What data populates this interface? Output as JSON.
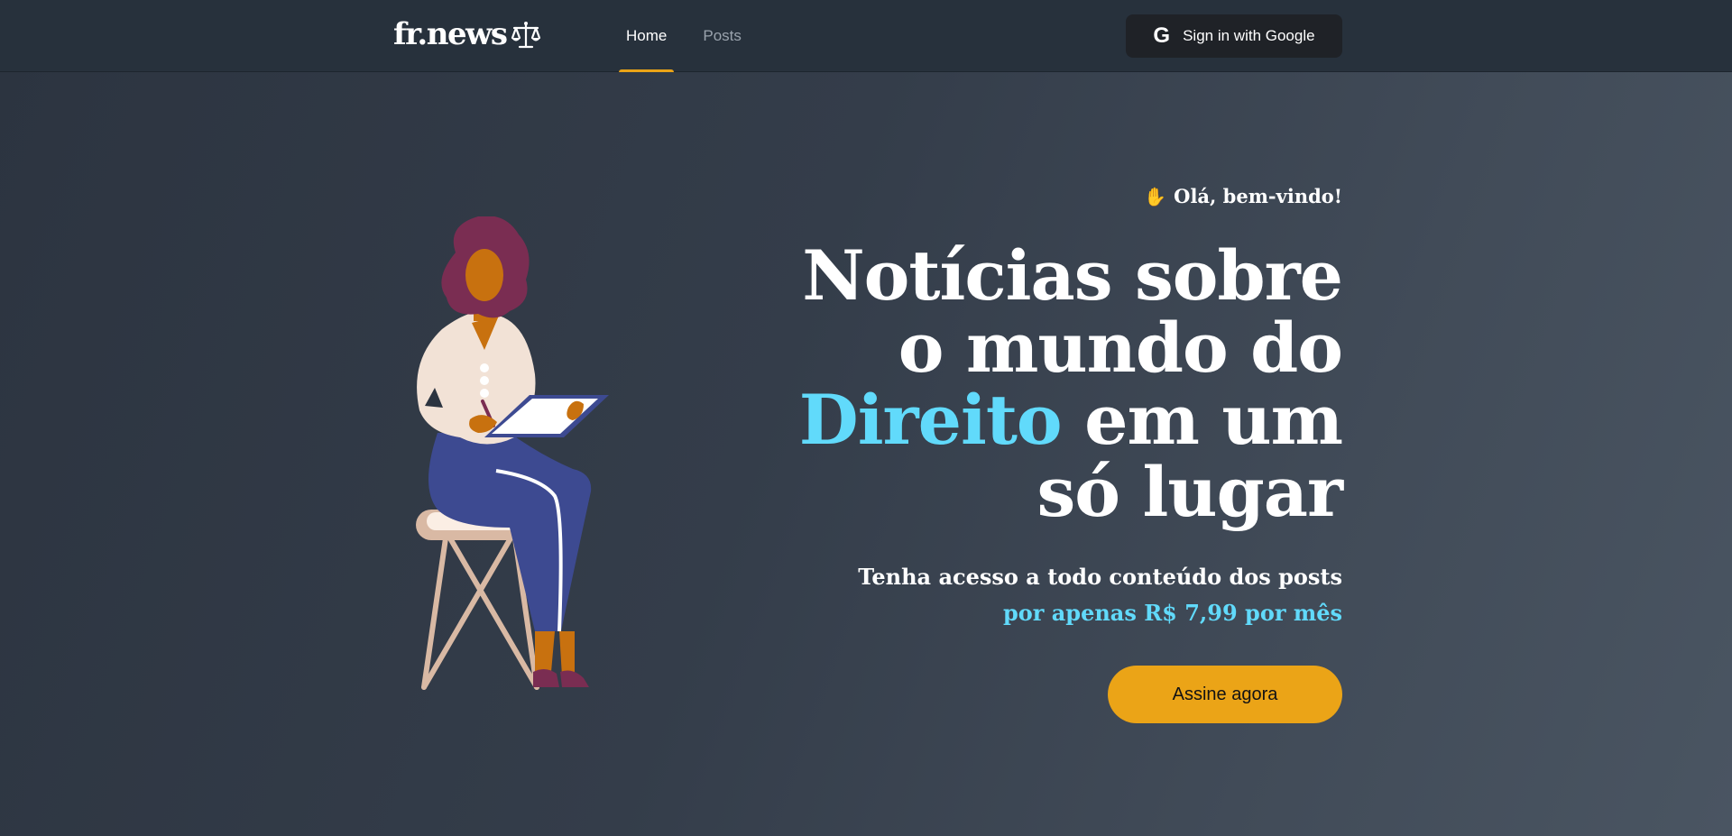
{
  "header": {
    "logo": "fr.news",
    "nav": [
      {
        "label": "Home",
        "active": true
      },
      {
        "label": "Posts",
        "active": false
      }
    ],
    "signin": {
      "label": "Sign in with Google",
      "icon": "google-icon"
    }
  },
  "hero": {
    "welcome": "Olá, bem-vindo!",
    "welcome_icon": "waving-hand-icon",
    "headline": {
      "before": "Notícias sobre o mundo do",
      "accent": "Direito",
      "after": "em um só lugar"
    },
    "subtitle_line1": "Tenha acesso a todo conteúdo dos posts",
    "subtitle_line2": "por apenas R$ 7,99 por mês",
    "cta": "Assine agora"
  },
  "colors": {
    "accent_cyan": "#61dafb",
    "accent_yellow": "#eba417",
    "header_bg": "#27313c"
  }
}
